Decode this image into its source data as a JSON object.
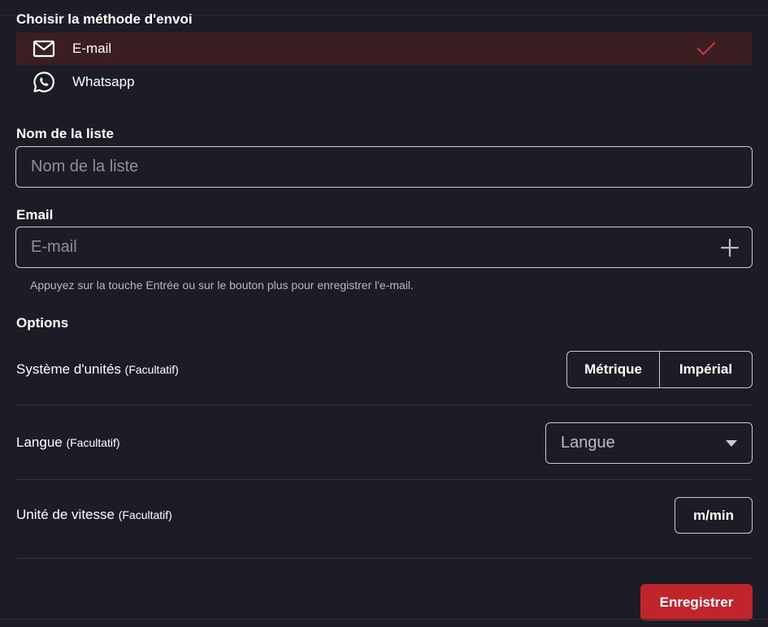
{
  "method": {
    "title": "Choisir la méthode d'envoi",
    "options": [
      {
        "label": "E-mail",
        "icon": "mail-icon",
        "selected": true
      },
      {
        "label": "Whatsapp",
        "icon": "whatsapp-icon",
        "selected": false
      }
    ]
  },
  "list_name": {
    "label": "Nom de la liste",
    "placeholder": "Nom de la liste",
    "value": ""
  },
  "email": {
    "label": "Email",
    "placeholder": "E-mail",
    "value": "",
    "hint": "Appuyez sur la touche Entrée ou sur le bouton plus pour enregistrer l'e-mail."
  },
  "options": {
    "title": "Options",
    "units": {
      "label": "Système d'unités",
      "optional": "(Facultatif)",
      "choices": [
        "Métrique",
        "Impérial"
      ]
    },
    "language": {
      "label": "Langue",
      "optional": "(Facultatif)",
      "placeholder": "Langue"
    },
    "speed": {
      "label": "Unité de vitesse",
      "optional": "(Facultatif)",
      "value": "m/min"
    }
  },
  "save_label": "Enregistrer",
  "colors": {
    "background": "#1b1c26",
    "selected_row": "#3a1e22",
    "accent": "#c0252c",
    "border": "#c9cbd3"
  }
}
